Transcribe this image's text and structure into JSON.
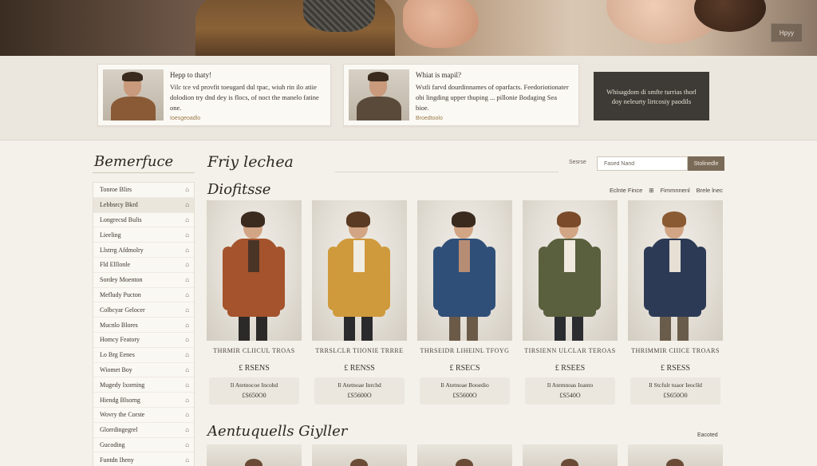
{
  "hero": {
    "button_label": "Hpyy"
  },
  "features": [
    {
      "title": "Hepp to thaty!",
      "text": "Vilc tce vd provfit toeugard dul tpac, wiuh rin ilo atiie dolodion try dnd dey is flocs, of noct the manelo fatine one.",
      "link": "Ioesgeoadlo"
    },
    {
      "title": "Whiat is mapil?",
      "text": "Wstli farvd dourdinnames of oparfacts. Feedoriotionater obi lingding upper thuping ... pillonie Bodaging Sea bioe.",
      "link": "Broedtoolo"
    }
  ],
  "promo": {
    "text": "Whisagdom di smfte turrias thorl doy neleurty lirtcosiy paodils"
  },
  "sidebar": {
    "title": "Bemerfuce",
    "items": [
      {
        "label": "Tonroe Blirs"
      },
      {
        "label": "Lebbsrcy Bkrd"
      },
      {
        "label": "Longrecsd Bulis"
      },
      {
        "label": "Lieeling"
      },
      {
        "label": "Llstrrg Afdmolry"
      },
      {
        "label": "Fld Elllonle"
      },
      {
        "label": "Sordey Moenton"
      },
      {
        "label": "Mefludy Pucton"
      },
      {
        "label": "Colbcyar Gelocer"
      },
      {
        "label": "Mucnlo Blores"
      },
      {
        "label": "Homcy Featory"
      },
      {
        "label": "Lo Brg Eenes"
      },
      {
        "label": "Wiomet Boy"
      },
      {
        "label": "Mugedy Ixorning"
      },
      {
        "label": "Hiendg Blsorng"
      },
      {
        "label": "Wovry the Corste"
      },
      {
        "label": "Glorrdingegrel"
      },
      {
        "label": "Gucoding"
      },
      {
        "label": "Funtdn Iheny"
      }
    ]
  },
  "main": {
    "title": "Friy lechea",
    "search_label": "Sesrse",
    "search_value": "Fased Nand",
    "search_button": "Stolinedle",
    "section_title": "Diofitsse",
    "sort_label": "Eclnte Fince",
    "sort_options": [
      "Fimmnnenl",
      "Brele lnec"
    ],
    "section2_title": "Aentuquells Giyller",
    "section2_link": "Eacoted"
  },
  "products": [
    {
      "name": "THRMIR CLIICUL TROAS",
      "price": "£ RSENS",
      "desc": "Il Atetnocoe Incohd",
      "value": "£S650O0",
      "coat": "#a4532c",
      "hair": "#3b2a1e",
      "shirt": "#4a3426",
      "legs": "#2c2a28"
    },
    {
      "name": "TRRSLCLR TIIONIE TRRRE",
      "price": "£ RENSS",
      "desc": "Il Atetnoae Inrchd",
      "value": "£S5600O",
      "coat": "#cf9a3c",
      "hair": "#5a3a22",
      "shirt": "#f1ece2",
      "legs": "#2a2a2c"
    },
    {
      "name": "THRSEIDR LIHEINL TFOYG",
      "price": "£ RSECS",
      "desc": "Il Atetnoae Booedio",
      "value": "£S5600O",
      "coat": "#2f4f78",
      "hair": "#3a2a1e",
      "shirt": "#b78c74",
      "legs": "#6b5a48"
    },
    {
      "name": "TIRSIENN ULCLAR TEROAS",
      "price": "£ RSEES",
      "desc": "Il Atemnoas Ioanto",
      "value": "£S540O",
      "coat": "#5a5f3e",
      "hair": "#7a4a2a",
      "shirt": "#efe9de",
      "legs": "#2a2c30"
    },
    {
      "name": "THRIMMIR CIIICE TROARS",
      "price": "£ RSESS",
      "desc": "Il Stcfulr tuaor Ieoclld",
      "value": "£S650O0",
      "coat": "#2c3a55",
      "hair": "#8a5a32",
      "shirt": "#e6e0d4",
      "legs": "#6a5c4a"
    }
  ],
  "colors": {
    "background": "#f4f1ea",
    "accent": "#7a6a58",
    "dark_panel": "#3e3b36"
  }
}
